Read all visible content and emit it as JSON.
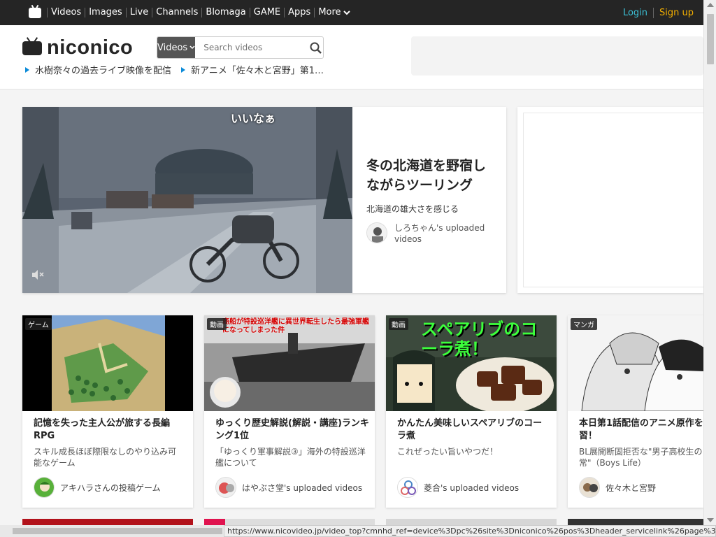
{
  "topnav": {
    "items": [
      "Videos",
      "Images",
      "Live",
      "Channels",
      "Blomaga",
      "GAME",
      "Apps"
    ],
    "more_label": "More",
    "login_label": "Login",
    "signup_label": "Sign up"
  },
  "header": {
    "logo_text": "niconico",
    "search_type": "Videos",
    "search_placeholder": "Search videos",
    "news": [
      "水樹奈々の過去ライブ映像を配信",
      "新アニメ「佐々木と宮野」第1…"
    ]
  },
  "hero": {
    "caption": "いいなぁ",
    "title": "冬の北海道を野宿しながらツーリング",
    "subtitle": "北海道の雄大さを感じる",
    "user": "しろちゃん's uploaded videos"
  },
  "cards": [
    {
      "tag": "ゲーム",
      "title": "記憶を失った主人公が旅する長編RPG",
      "desc": "スキル成長ほぼ際限なしのやり込み可能なゲーム",
      "user": "アキハラさんの投稿ゲーム"
    },
    {
      "tag": "動画",
      "title": "ゆっくり歴史解説(解説・講座)ランキング1位",
      "desc": "「ゆっくり軍事解説③」海外の特設巡洋艦について",
      "user": "はやぶさ堂's uploaded videos",
      "thumb_text": "商船が特設巡洋艦に異世界転生したら最強軍艦になってしまった件"
    },
    {
      "tag": "動画",
      "title": "かんたん美味しいスペアリブのコーラ煮",
      "desc": "これぜったい旨いやつだ！",
      "user": "菱合's uploaded videos",
      "thumb_text": "スペアリブのコーラ煮！"
    },
    {
      "tag": "マンガ",
      "title": "本日第1話配信のアニメ原作を予習！",
      "desc": "BL展開断固拒否な\"男子高校生の日常\"（Boys Life）",
      "user": "佐々木と宮野"
    }
  ],
  "status_url": "https://www.nicovideo.jp/video_top?cmnhd_ref=device%3Dpc%26site%3Dniconico%26pos%3Dheader_servicelink%26page%3Dtop"
}
